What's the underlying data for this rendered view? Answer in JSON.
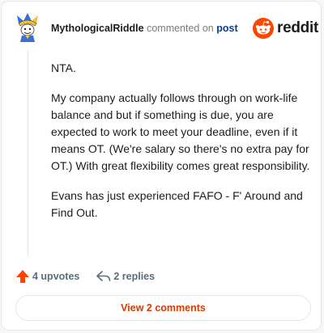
{
  "header": {
    "username": "MythologicalRiddle",
    "commented_text": "commented on",
    "post_link": "post"
  },
  "brand": {
    "wordmark": "reddit",
    "color": "#ff4500"
  },
  "comment": {
    "paragraphs": [
      "NTA.",
      "My company actually follows through on work-life balance and but if something is due, you are expected to work to meet your deadline, even if it means OT. (We're salary so there's no extra pay for OT.) With great flexibility comes great responsibility.",
      "Evans has just experienced FAFO - F' Around and Find Out."
    ]
  },
  "actions": {
    "upvotes_label": "4 upvotes",
    "replies_label": "2 replies",
    "upvote_color": "#ff4500"
  },
  "footer": {
    "view_comments_label": "View 2 comments",
    "accent_color": "#d93a00"
  },
  "icons": {
    "avatar": "jester-avatar-icon",
    "upvote": "upvote-arrow-icon",
    "reply": "reply-arrow-icon",
    "logo": "reddit-snoo-icon"
  }
}
